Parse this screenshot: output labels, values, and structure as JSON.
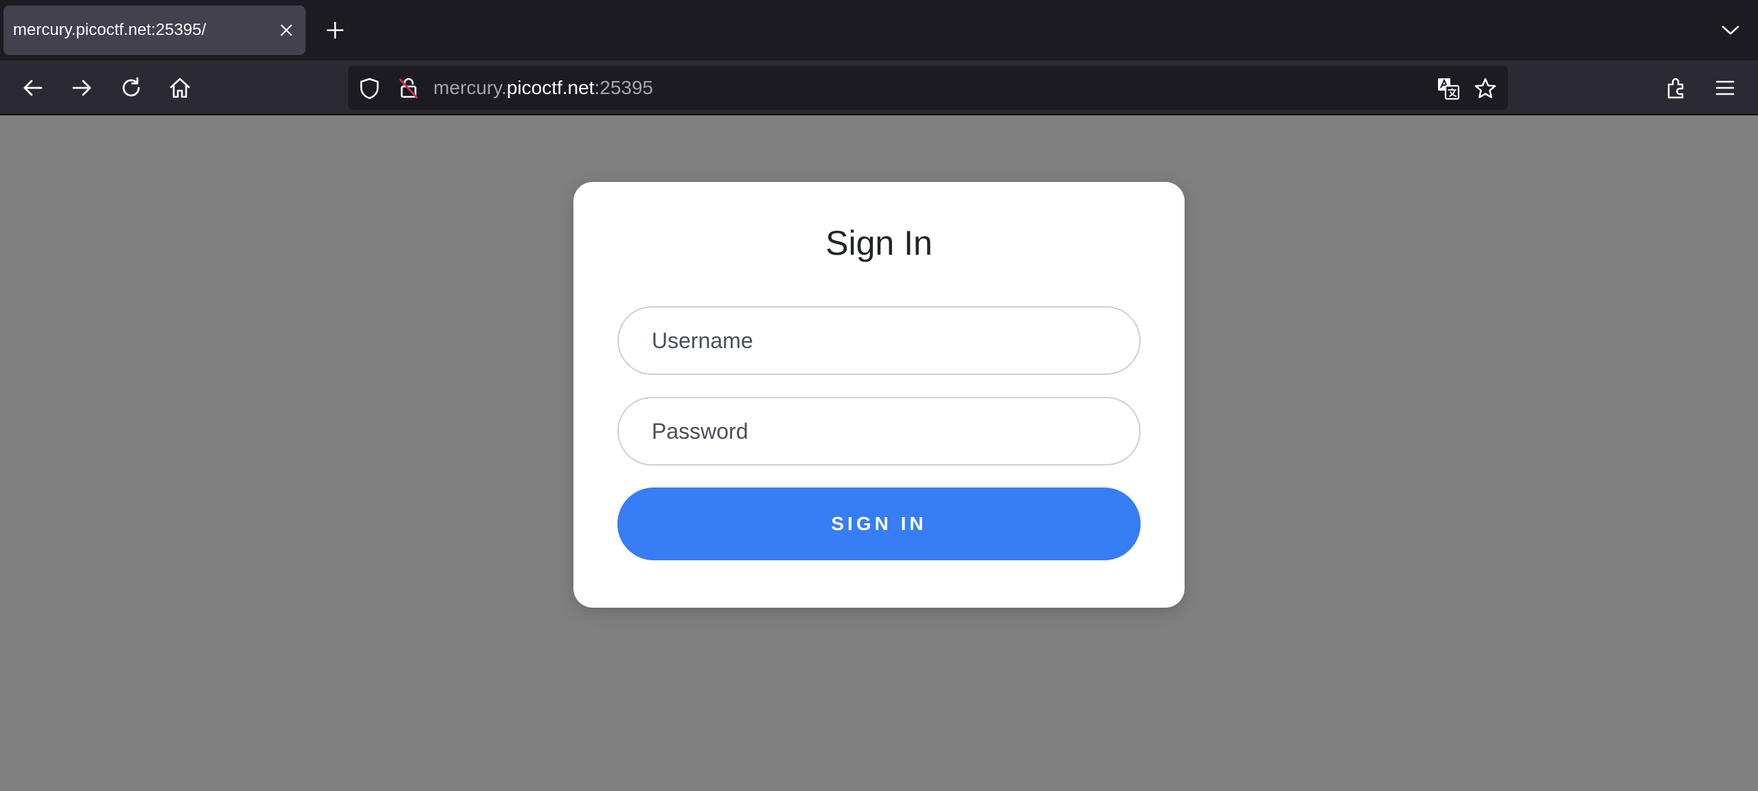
{
  "browser": {
    "tab": {
      "title": "mercury.picoctf.net:25395/"
    },
    "url": {
      "prefix": "mercury.",
      "host": "picoctf.net",
      "port": ":25395"
    },
    "icons": {
      "tab_close": "close-icon",
      "new_tab": "plus-icon",
      "tab_list": "chevron-down-icon",
      "back": "arrow-left-icon",
      "forward": "arrow-right-icon",
      "reload": "reload-icon",
      "home": "home-icon",
      "shield": "shield-icon",
      "insecure_lock": "insecure-lock-icon",
      "translate": "translate-icon",
      "bookmark": "star-icon",
      "extensions": "extensions-icon",
      "menu": "hamburger-menu-icon"
    },
    "colors": {
      "tabbar_bg": "#1c1b22",
      "navbar_bg": "#2b2a33",
      "active_tab_bg": "#42414d"
    }
  },
  "page": {
    "background": "#808080",
    "login": {
      "title": "Sign In",
      "username_placeholder": "Username",
      "username_value": "",
      "password_placeholder": "Password",
      "password_value": "",
      "submit_label": "SIGN IN",
      "button_color": "#377df5"
    }
  }
}
